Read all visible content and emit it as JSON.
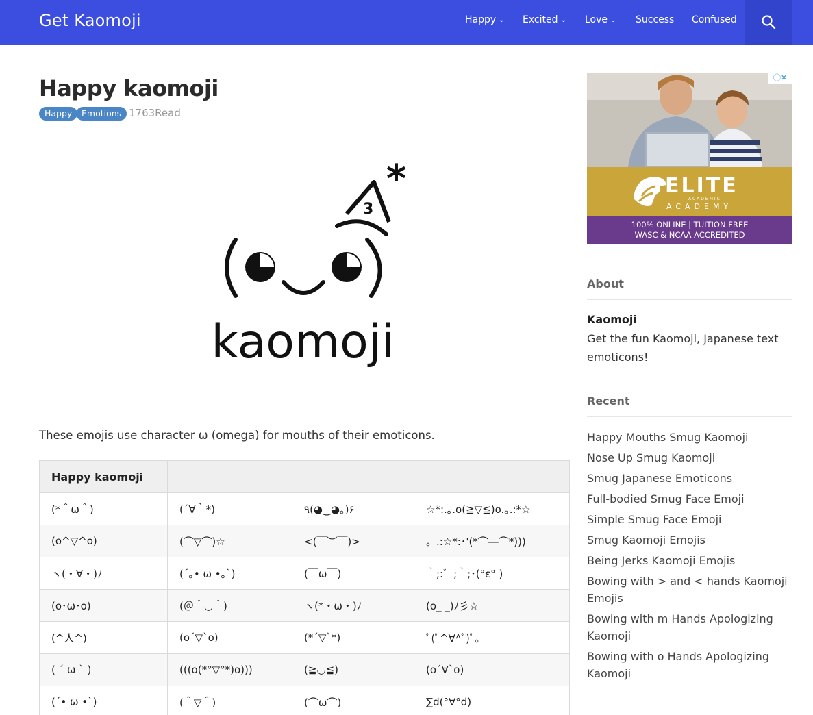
{
  "header": {
    "brand": "Get Kaomoji",
    "nav": [
      {
        "label": "Happy",
        "dropdown": true
      },
      {
        "label": "Excited",
        "dropdown": true
      },
      {
        "label": "Love",
        "dropdown": true
      },
      {
        "label": "Success",
        "dropdown": false
      },
      {
        "label": "Confused",
        "dropdown": false
      }
    ],
    "search_icon": "search-icon",
    "colors": {
      "bar": "#3b4ee0",
      "search_bg": "#3344cc"
    }
  },
  "article": {
    "title": "Happy kaomoji",
    "tags": [
      "Happy",
      "Emotions"
    ],
    "reads": "1763Read",
    "hero": {
      "face": "(◕‿◕)",
      "wordmark": "kaomoji",
      "hat_number": "3",
      "star": "*"
    },
    "intro": "These emojis use character ω (omega) for mouths of their emoticons.",
    "table": {
      "headers": [
        "Happy kaomoji",
        "",
        "",
        ""
      ],
      "rows": [
        [
          "(*＾ω＾)",
          "(´∀｀*)",
          "٩(◕‿◕｡)۶",
          "☆*:.｡.o(≧▽≦)o.｡.:*☆"
        ],
        [
          "(o^▽^o)",
          "(⌒▽⌒)☆",
          "<(￣︶￣)>",
          "。.:☆*:･'(*⌒―⌒*)))"
        ],
        [
          "ヽ(・∀・)ﾉ",
          "(´｡• ω •｡`)",
          "(￣ω￣)",
          "｀;:゛;｀;･(°ε° )"
        ],
        [
          "(o･ω･o)",
          "(＠＾◡＾)",
          "ヽ(*・ω・)ﾉ",
          "(o_ _)ﾉ彡☆"
        ],
        [
          "(^人^)",
          "(o´▽`o)",
          "(*´▽`*)",
          "ﾟ(ﾟ^∀^ﾟ)ﾟ｡"
        ],
        [
          "( ´ ω ` )",
          "(((o(*°▽°*)o)))",
          "(≧◡≦)",
          "(o´∀`o)"
        ],
        [
          "(´• ω •`)",
          "(＾▽＾)",
          "(⌒ω⌒)",
          "∑d(°∀°d)"
        ]
      ]
    }
  },
  "sidebar": {
    "ad": {
      "brand": "ELITE",
      "sub1": "ACADEMIC",
      "sub2": "ACADEMY",
      "line1": "100% ONLINE  |  TUITION FREE",
      "line2": "WASC & NCAA ACCREDITED",
      "close": "ⓘ✕"
    },
    "about": {
      "heading": "About",
      "name": "Kaomoji",
      "text": "Get the fun Kaomoji, Japanese text emoticons!"
    },
    "recent": {
      "heading": "Recent",
      "items": [
        "Happy Mouths Smug Kaomoji",
        "Nose Up Smug Kaomoji",
        "Smug Japanese Emoticons",
        "Full-bodied Smug Face Emoji",
        "Simple Smug Face Emoji",
        "Smug Kaomoji Emojis",
        "Being Jerks Kaomoji Emojis",
        "Bowing with > and < hands Kaomoji Emojis",
        "Bowing with m Hands Apologizing Kaomoji",
        "Bowing with o Hands Apologizing Kaomoji"
      ]
    }
  }
}
